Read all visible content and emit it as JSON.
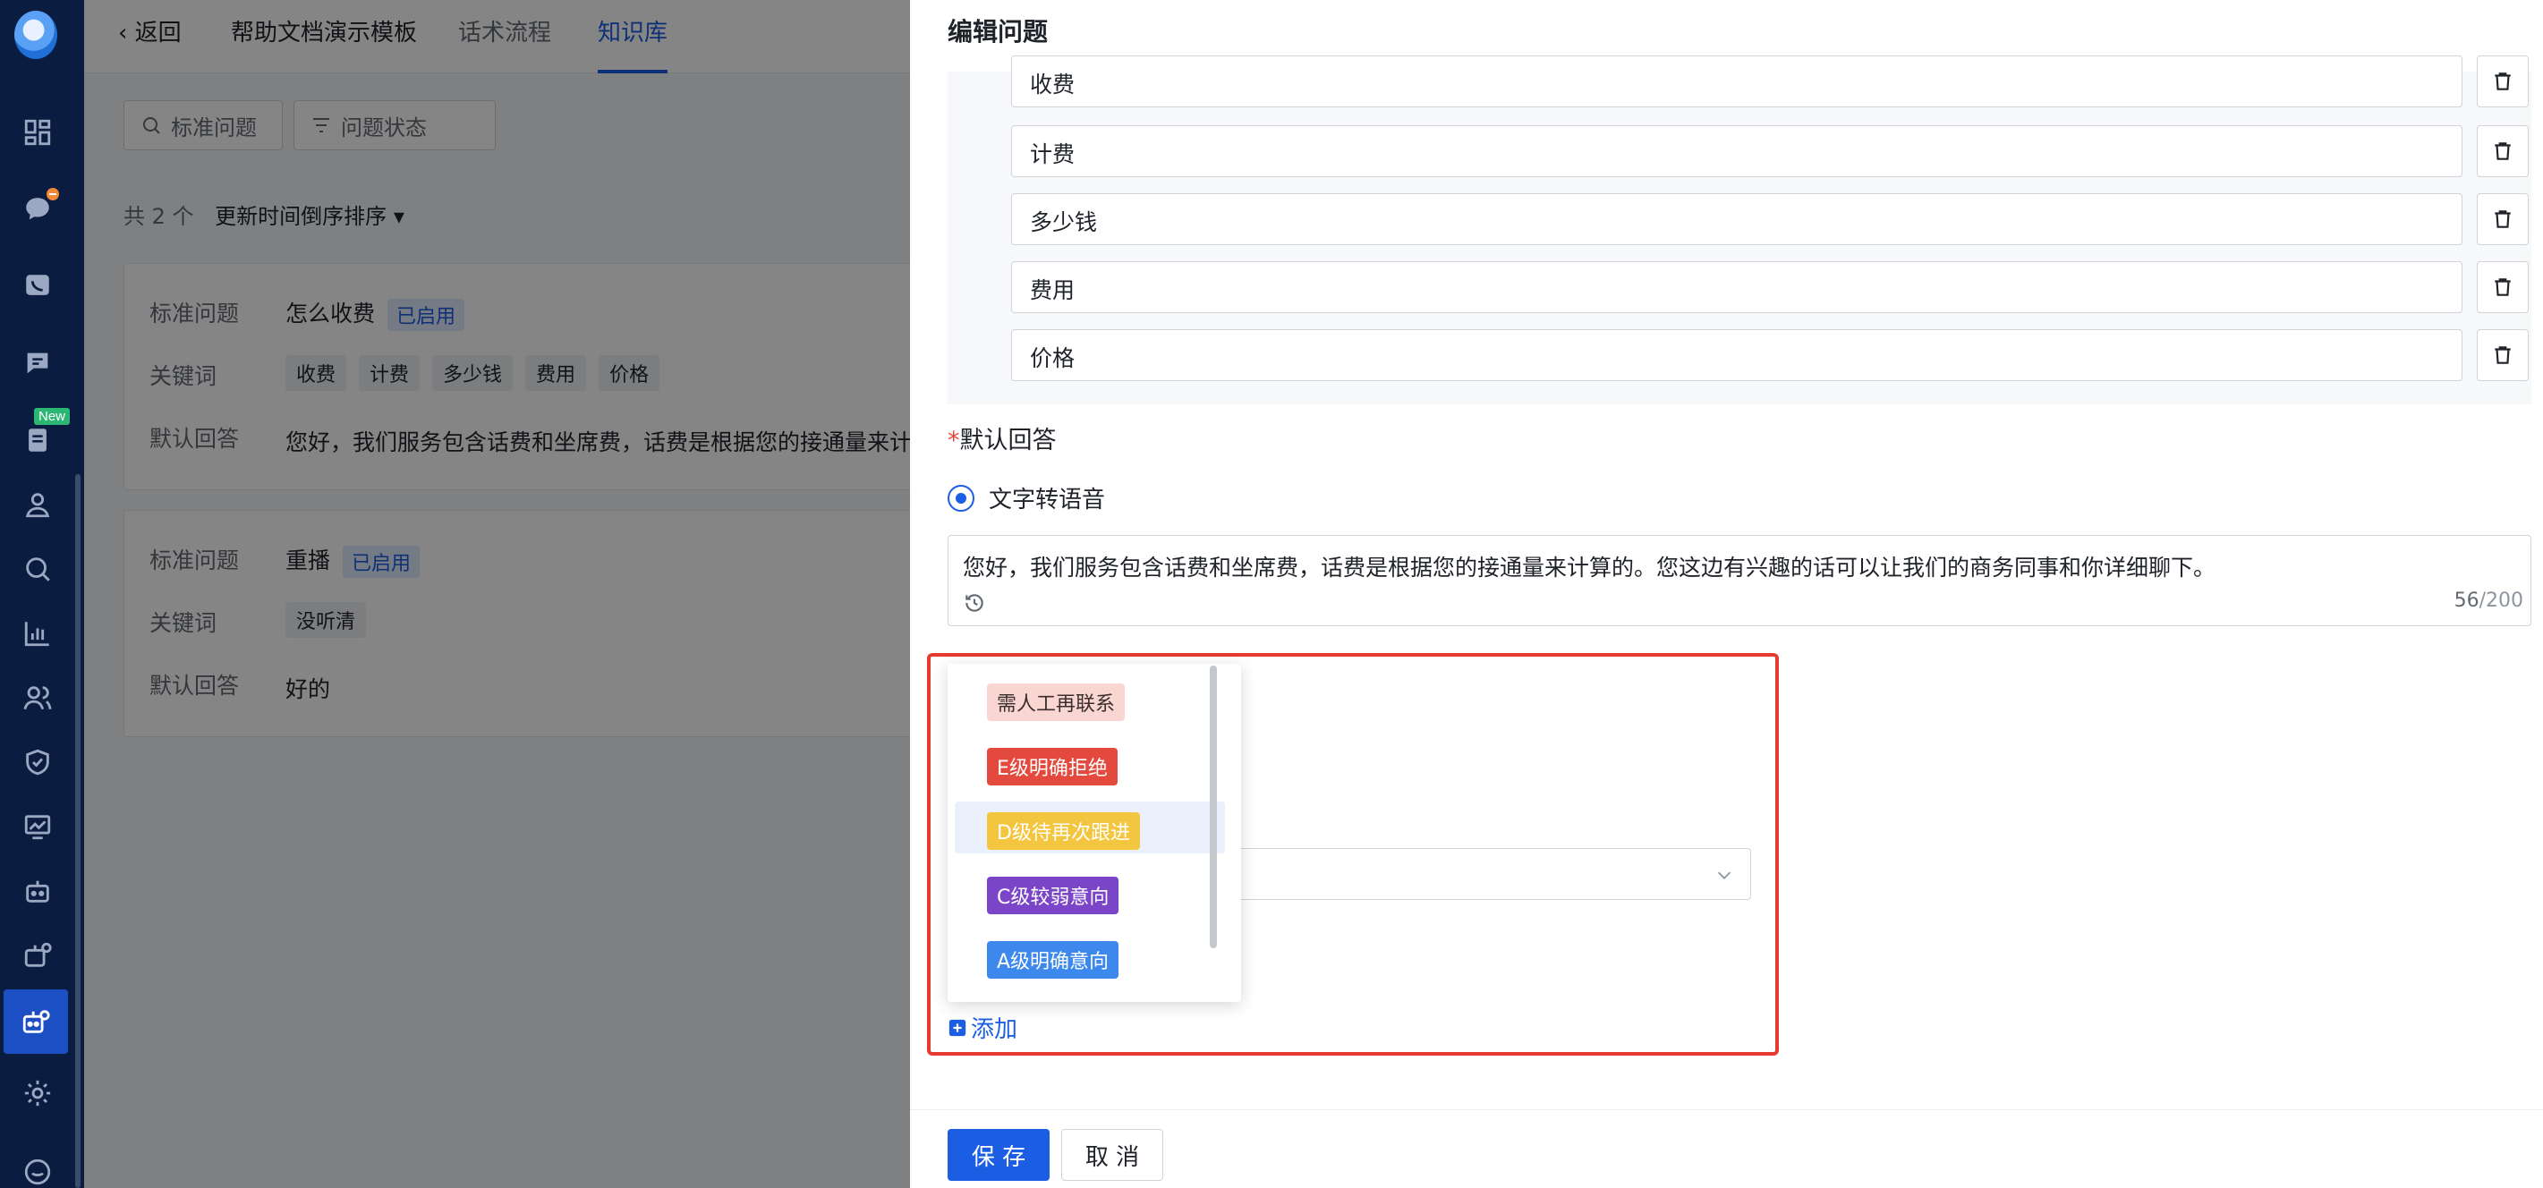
{
  "topbar": {
    "back_label": "返回",
    "title": "帮助文档演示模板",
    "tab_flow": "话术流程",
    "tab_kb": "知识库"
  },
  "filters": {
    "std_question": "标准问题",
    "question_status": "问题状态"
  },
  "list": {
    "count_text": "共 2 个",
    "sort_label": "更新时间倒序排序"
  },
  "cards": [
    {
      "std_label": "标准问题",
      "question": "怎么收费",
      "status": "已启用",
      "keywords_label": "关键词",
      "keywords": [
        "收费",
        "计费",
        "多少钱",
        "费用",
        "价格"
      ],
      "answer_label": "默认回答",
      "answer": "您好，我们服务包含话费和坐席费，话费是根据您的接通量来计"
    },
    {
      "std_label": "标准问题",
      "question": "重播",
      "status": "已启用",
      "keywords_label": "关键词",
      "keywords": [
        "没听清"
      ],
      "answer_label": "默认回答",
      "answer": "好的"
    }
  ],
  "drawer": {
    "title": "编辑问题",
    "keyword_inputs": [
      "收费",
      "计费",
      "多少钱",
      "费用",
      "价格"
    ],
    "answer_label": "默认回答",
    "answer_required_mark": "*",
    "radio_label": "文字转语音",
    "answer_text": "您好，我们服务包含话费和坐席费，话费是根据您的接通量来计算的。您这边有兴趣的话可以让我们的商务同事和你详细聊下。",
    "answer_count": "56",
    "answer_max": "/200",
    "dropdown_options": [
      {
        "label": "需人工再联系",
        "bg": "#f9d6d2",
        "fg": "#3a2f2c"
      },
      {
        "label": "E级明确拒绝",
        "bg": "#e4493d",
        "fg": "#ffffff"
      },
      {
        "label": "D级待再次跟进",
        "bg": "#f4c53e",
        "fg": "#ffffff"
      },
      {
        "label": "C级较弱意向",
        "bg": "#7b45c8",
        "fg": "#ffffff"
      },
      {
        "label": "A级明确意向",
        "bg": "#3c88ec",
        "fg": "#ffffff"
      }
    ],
    "hovered_option": "D级待再次跟进",
    "add_label": "添加",
    "save_label": "保 存",
    "cancel_label": "取 消"
  },
  "colors": {
    "accent": "#1b5de3",
    "nav_bg": "#0a1d40",
    "highlight_border": "#e43b2e"
  },
  "nav": {
    "badge_new": "New",
    "icons": [
      "dashboard-icon",
      "chat-icon",
      "phone-icon",
      "message-icon",
      "document-icon",
      "user-icon",
      "search-chart-icon",
      "bar-chart-icon",
      "team-icon",
      "shield-icon",
      "monitor-chart-icon",
      "robot-icon",
      "robot-settings-icon",
      "robot-active-icon",
      "settings-icon",
      "support-icon"
    ]
  }
}
